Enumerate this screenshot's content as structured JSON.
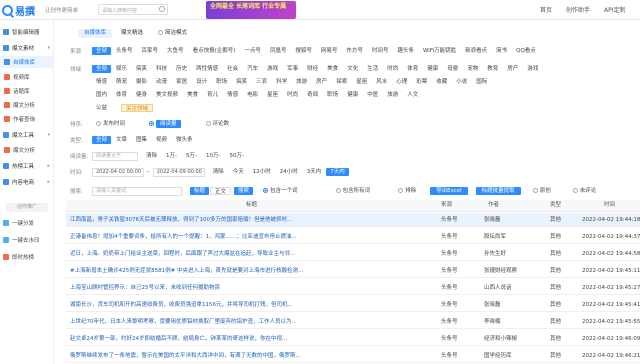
{
  "app": {
    "logo": "易撰",
    "slogan": "让创作更简单",
    "search_placeholder": "请输入搜索内容",
    "banner": "全网最全 长尾词库 行业专属"
  },
  "topnav": [
    "首页",
    "创作助手",
    "API定制"
  ],
  "sidebar": {
    "items": [
      {
        "label": "智能编辑器",
        "icon": "editor-icon"
      },
      {
        "label": "爆文素材",
        "icon": "folder-icon",
        "group": true
      },
      {
        "label": "自媒体库",
        "icon": "article-icon",
        "active": true
      },
      {
        "label": "视频库",
        "icon": "video-icon"
      },
      {
        "label": "话题库",
        "icon": "topic-icon"
      },
      {
        "label": "爆文分析",
        "icon": "chart-icon"
      },
      {
        "label": "作者查询",
        "icon": "user-search-icon"
      },
      {
        "label": "爆文工具",
        "icon": "tools-icon",
        "group": true
      },
      {
        "label": "爆文分析",
        "icon": "analysis-icon"
      },
      {
        "label": "热榜工具",
        "icon": "hot-icon",
        "group": true
      },
      {
        "label": "内容电商",
        "icon": "shop-icon",
        "group": true
      }
    ],
    "divider": "创作推广",
    "bottom": [
      {
        "label": "一键分发",
        "icon": "share-icon"
      },
      {
        "label": "一键去水印",
        "icon": "watermark-icon"
      },
      {
        "label": "即时热榜",
        "icon": "clock-icon"
      }
    ]
  },
  "tabs": [
    "自媒体库",
    "爆文精选",
    "简洁模式"
  ],
  "filters": {
    "source_label": "来源",
    "sources": [
      "全部",
      "头条号",
      "百家号",
      "大鱼号",
      "看点快报(企鹅号)",
      "一点号",
      "凤凰号",
      "搜狐号",
      "网易号",
      "东方号",
      "时间号",
      "趣头条",
      "WiFi万能钥匙",
      "新浪看点",
      "简书",
      "QQ看点"
    ],
    "field_label": "领域",
    "fields": [
      "全部",
      "娱乐",
      "搞笑",
      "科技",
      "历史",
      "两性情感",
      "社会",
      "汽车",
      "游戏",
      "军事",
      "财经",
      "美食",
      "文化",
      "生活",
      "时尚",
      "体育",
      "健康",
      "母婴",
      "宠物",
      "教育",
      "房产",
      "游戏",
      "情感",
      "萌宠",
      "摄影",
      "动漫",
      "家居",
      "设计",
      "职场",
      "搞笑",
      "三农",
      "科学",
      "旅游",
      "房产",
      "探索",
      "星座",
      "风水",
      "心理",
      "彩票",
      "收藏",
      "小说",
      "国际",
      "国内",
      "体育",
      "健身",
      "美文视频",
      "美食",
      "育儿",
      "情感",
      "电影",
      "星座",
      "时尚",
      "奇闻",
      "职场",
      "健康",
      "中医",
      "旅游",
      "人文",
      "公益"
    ],
    "focus_label": "关注领域",
    "sort_label": "排序:",
    "sorts": [
      "发布时间",
      "阅读量",
      "评论数"
    ],
    "type_label": "类型:",
    "types": [
      "全部",
      "文章",
      "图集",
      "视频",
      "微头条"
    ],
    "read_label": "阅读量:",
    "read_placeholder": "阅读量大于",
    "read_options": [
      "清除",
      "1万-",
      "5万-",
      "10万-",
      "50万-"
    ],
    "time_label": "时间:",
    "date_from": "2022-04-02 00:00",
    "date_to": "2022-04-09 00:00",
    "time_options": [
      "清除",
      "今天",
      "12小时",
      "24小时",
      "3天内",
      "7天内"
    ],
    "search_label": "搜索:",
    "search_placeholder": "请输入关键词",
    "search_modes": [
      "标题",
      "正文"
    ],
    "search_btn": "搜索",
    "options": [
      "包含一个词",
      "包含所有词",
      "排除"
    ],
    "export_btn": "导出Excel",
    "batch_btn": "标题批量提取",
    "extra": [
      "原创",
      "未评论"
    ]
  },
  "table": {
    "headers": [
      "标题",
      "来源",
      "作者",
      "类型",
      "时间"
    ],
    "rows": [
      {
        "title": "江西南昌，男子关铁窗3076天后被无罪释放，得到了100多万的国家赔偿！但是他被抓时...",
        "source": "头条号",
        "author": "张晓磊",
        "type": "其他",
        "time": "2022-04-02 19:44:18",
        "hi": true
      },
      {
        "title": "正港备伟息！增加4个重要词条，给所有人的一个提醒：1、鸿蒙……；比亚迪宣布停止燃油...",
        "source": "头条号",
        "author": "股坛尚军",
        "type": "其他",
        "time": "2022-04-02 19:44:37"
      },
      {
        "title": "近日，上海。奶奶带上门给业主送菜，回程时，后面跟了声过大爆盆在追赶，导致业主与邻...",
        "source": "头条号",
        "author": "孙先生好",
        "type": "其他",
        "time": "2022-04-02 19:44:58"
      },
      {
        "title": "#上海新增本土确诊425例无症状8581例# 中央进入上海，首先就是要对上海市进行核酸检测...",
        "source": "头条号",
        "author": "张捷财经观察",
        "type": "其他",
        "time": "2022-04-02 19:45:11"
      },
      {
        "title": "上海宝山顾村管控界示：自己25号以来，未收到任何援助物资",
        "source": "头条号",
        "author": "山西人说话",
        "type": "其他",
        "time": "2022-04-02 19:45:27"
      },
      {
        "title": "湖南长沙，货车司机和开的高速收费员，收费员强迫拿1156元，并将导司机打残，但司机...",
        "source": "头条号",
        "author": "张晓磊",
        "type": "其他",
        "time": "2022-04-02 19:45:41"
      },
      {
        "title": "上世纪70年代，日本人来黎明考察，竟要用优质铝材换取厂里废弃的铝炉渣，工作人员以为...",
        "source": "头条号",
        "author": "李晓楠",
        "type": "其他",
        "time": "2022-04-02 19:45:55"
      },
      {
        "title": "赵文卓24岁第一部，约好24岁即结婚后不顾，结局身亡。钟某某的哥这样说，你在中视...",
        "source": "头条号",
        "author": "经济和小辣椒",
        "type": "其他",
        "time": "2022-04-02 19:46:09"
      },
      {
        "title": "俄罗斯继续发布了一条地震，暂示在美国的太平洋和大西洋中间，有满了无数的中国，俄罗斯...",
        "source": "头条号",
        "author": "国学经历库",
        "type": "其他",
        "time": "2022-04-02 19:46:21"
      }
    ]
  }
}
